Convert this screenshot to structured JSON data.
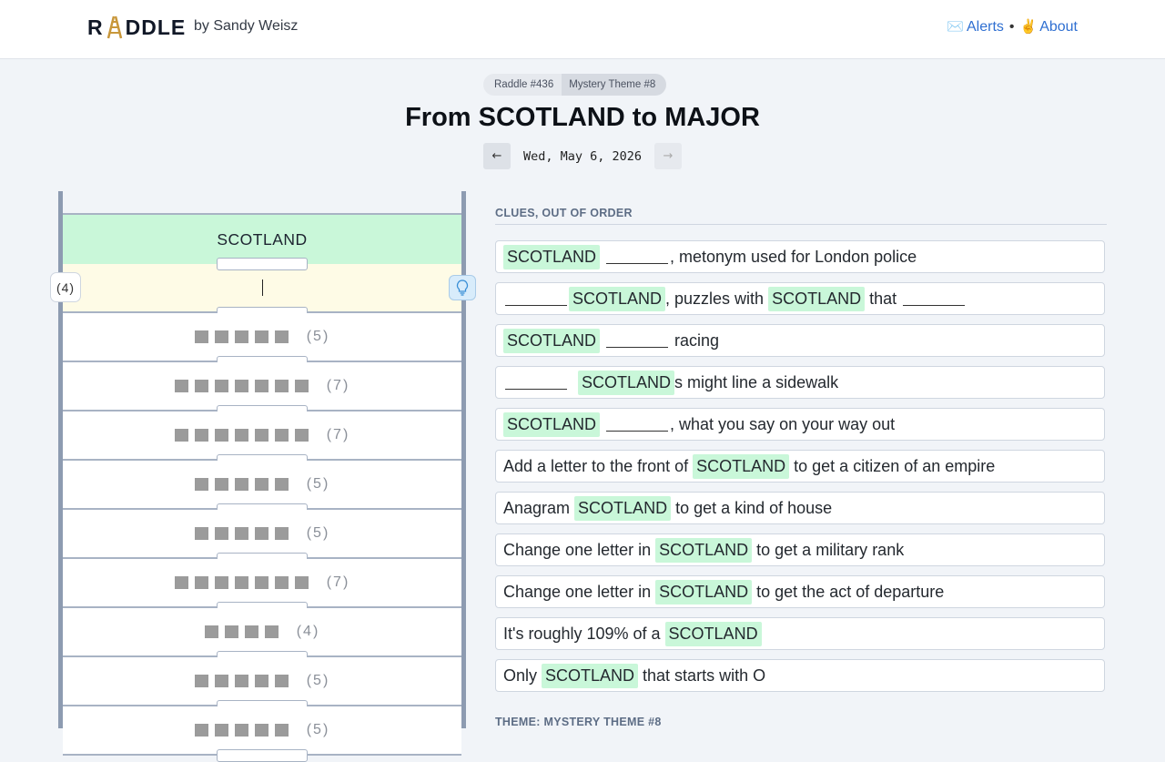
{
  "header": {
    "logo_letters": [
      "R",
      "DDLE"
    ],
    "byline": "by Sandy Weisz",
    "nav": [
      {
        "icon": "envelope-icon",
        "emoji": "✉️",
        "label": "Alerts"
      },
      {
        "icon": "peace-hand-icon",
        "emoji": "✌️",
        "label": "About"
      }
    ],
    "nav_separator": "•"
  },
  "puzzle": {
    "number_label": "Raddle #436",
    "theme_label": "Mystery Theme #8",
    "title": "From SCOTLAND to MAJOR",
    "date": "Wed, May 6, 2026",
    "prev_arrow": "←",
    "next_arrow": "→"
  },
  "ladder": {
    "start_word": "SCOTLAND",
    "active_length_label": "(4)",
    "rungs": [
      {
        "letters": 5,
        "label": "(5)"
      },
      {
        "letters": 7,
        "label": "(7)"
      },
      {
        "letters": 7,
        "label": "(7)"
      },
      {
        "letters": 5,
        "label": "(5)"
      },
      {
        "letters": 5,
        "label": "(5)"
      },
      {
        "letters": 7,
        "label": "(7)"
      },
      {
        "letters": 4,
        "label": "(4)"
      },
      {
        "letters": 5,
        "label": "(5)"
      },
      {
        "letters": 5,
        "label": "(5)"
      }
    ]
  },
  "clues": {
    "heading": "CLUES, OUT OF ORDER",
    "word": "SCOTLAND",
    "items": [
      [
        {
          "t": "tag"
        },
        {
          "t": "text",
          "v": " "
        },
        {
          "t": "blank"
        },
        {
          "t": "text",
          "v": ", metonym used for London police"
        }
      ],
      [
        {
          "t": "blank"
        },
        {
          "t": "tag"
        },
        {
          "t": "text",
          "v": ", puzzles with "
        },
        {
          "t": "tag"
        },
        {
          "t": "text",
          "v": " that "
        },
        {
          "t": "blank"
        }
      ],
      [
        {
          "t": "tag"
        },
        {
          "t": "text",
          "v": " "
        },
        {
          "t": "blank"
        },
        {
          "t": "text",
          "v": " racing"
        }
      ],
      [
        {
          "t": "blank"
        },
        {
          "t": "text",
          "v": "  "
        },
        {
          "t": "tag"
        },
        {
          "t": "text",
          "v": "s might line a sidewalk"
        }
      ],
      [
        {
          "t": "tag"
        },
        {
          "t": "text",
          "v": " "
        },
        {
          "t": "blank"
        },
        {
          "t": "text",
          "v": ", what you say on your way out"
        }
      ],
      [
        {
          "t": "text",
          "v": "Add a letter to the front of "
        },
        {
          "t": "tag"
        },
        {
          "t": "text",
          "v": " to get a citizen of an empire"
        }
      ],
      [
        {
          "t": "text",
          "v": "Anagram "
        },
        {
          "t": "tag"
        },
        {
          "t": "text",
          "v": " to get a kind of house"
        }
      ],
      [
        {
          "t": "text",
          "v": "Change one letter in "
        },
        {
          "t": "tag"
        },
        {
          "t": "text",
          "v": " to get a military rank"
        }
      ],
      [
        {
          "t": "text",
          "v": "Change one letter in "
        },
        {
          "t": "tag"
        },
        {
          "t": "text",
          "v": " to get the act of departure"
        }
      ],
      [
        {
          "t": "text",
          "v": "It's roughly 109% of a "
        },
        {
          "t": "tag"
        }
      ],
      [
        {
          "t": "text",
          "v": "Only "
        },
        {
          "t": "tag"
        },
        {
          "t": "text",
          "v": " that starts with O"
        }
      ]
    ],
    "theme_heading": "THEME: MYSTERY THEME #8"
  }
}
